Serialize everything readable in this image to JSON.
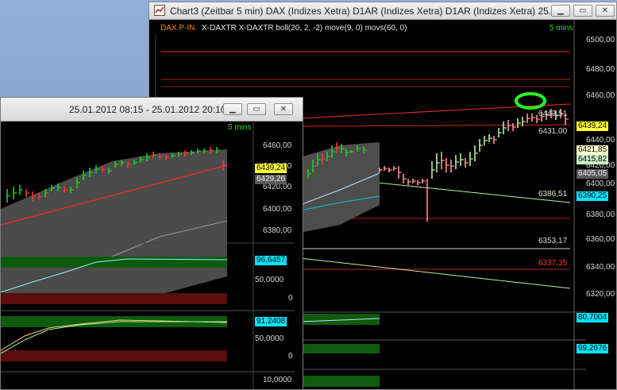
{
  "chart3": {
    "title": "Chart3 (Zeitbar 5 min)  DAX (Indizes Xetra) D1AR (Indizes Xetra) D1AR (Indizes Xetra) 25...",
    "legend_prefix": "DAX P-IN.",
    "legend_text": "X-DAXTR X-DAXTR boll(20, 2, -2) move(9, 0) movs(60, 0)",
    "interval": "5 mins",
    "y_axis": [
      "6500,00",
      "6480,00",
      "6460,00",
      "6440,00",
      "6420,00",
      "6400,00",
      "6380,00",
      "6360,00",
      "6340,00",
      "6320,00"
    ],
    "labels": {
      "p6443": "6443,51",
      "p6431": "6431,00",
      "p6439": "6439,24",
      "p6421": "6421,85",
      "p6415": "6415,82",
      "p6405": "6405,05",
      "p6386": "6386,51",
      "p6390": "6390,25",
      "p6353": "6353,17",
      "p6337": "6337,35",
      "ind1": "80,7004",
      "ind2": "99,2676"
    }
  },
  "chart_small": {
    "title": "25.01.2012 08:15 - 25.01.2012 20:10",
    "interval": "5 mins",
    "y_axis": [
      "6460,00",
      "6440,00",
      "6420,00",
      "6400,00",
      "6380,00"
    ],
    "labels": {
      "last": "6439,24",
      "ma": "6429,26",
      "ind1": "96,6457",
      "ind1_mid": "50,0000",
      "ind1_zero": "0",
      "ind2": "91,2408",
      "ind2_mid": "50,0000",
      "ind2_zero": "0",
      "ind3_top": "10,0000"
    }
  },
  "colors": {
    "up": "#22cc22",
    "down": "#ff3333",
    "price_label": "#ffff33",
    "band": "#5a5a5a",
    "accent_cyan": "#00ffff"
  }
}
